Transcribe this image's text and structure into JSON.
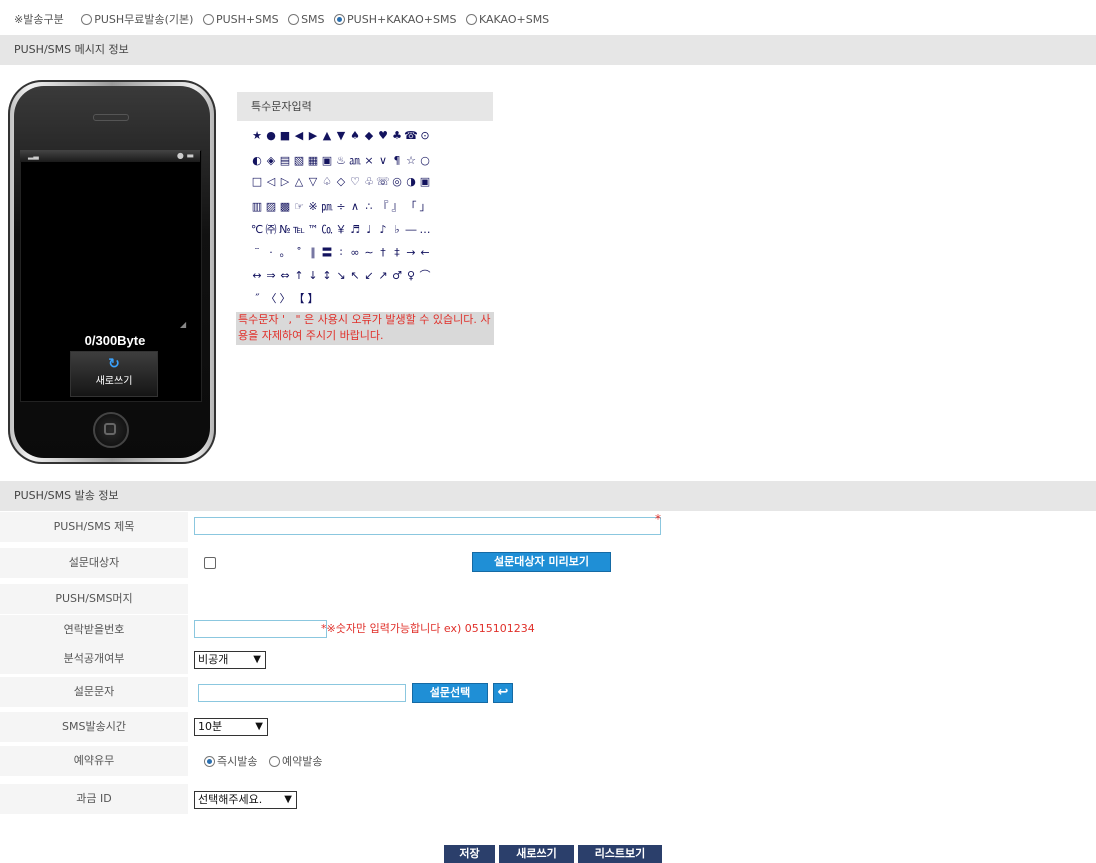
{
  "send_type": {
    "label": "※발송구분",
    "options": [
      {
        "label": "PUSH무료발송(기본)",
        "selected": false
      },
      {
        "label": "PUSH+SMS",
        "selected": false
      },
      {
        "label": "SMS",
        "selected": false
      },
      {
        "label": "PUSH+KAKAO+SMS",
        "selected": true
      },
      {
        "label": "KAKAO+SMS",
        "selected": false
      }
    ]
  },
  "message_section": {
    "title": "PUSH/SMS 메시지 정보"
  },
  "phone": {
    "byte_counter": "0/300Byte",
    "rewrite_label": "새로쓰기"
  },
  "special_chars": {
    "title": "특수문자입력",
    "rows": [
      [
        "★",
        "●",
        "■",
        "◀",
        "▶",
        "▲",
        "▼",
        "♠",
        "◆",
        "♥",
        "♣",
        "☎",
        "⊙"
      ],
      [
        "◐",
        "◈",
        "▤",
        "▧",
        "▦",
        "▣",
        "♨",
        "㏂",
        "×",
        "∨",
        "¶",
        "☆",
        "○"
      ],
      [
        "□",
        "◁",
        "▷",
        "△",
        "▽",
        "♤",
        "◇",
        "♡",
        "♧",
        "☏",
        "◎",
        "◑",
        "▣"
      ],
      [
        "▥",
        "▨",
        "▩",
        "☞",
        "※",
        "㏘",
        "÷",
        "∧",
        "∴",
        "『",
        "』",
        "「",
        "」"
      ],
      [
        "℃",
        "㈜",
        "№",
        "℡",
        "™",
        "㏇",
        "￥",
        "♬",
        "♩",
        "♪",
        "♭",
        "―",
        "…"
      ],
      [
        "¨",
        "·",
        "。",
        "˚",
        "∥",
        "〓",
        "∶",
        "∞",
        "∼",
        "†",
        "‡",
        "→",
        "←"
      ],
      [
        "↔",
        "⇒",
        "⇔",
        "↑",
        "↓",
        "↕",
        "↘",
        "↖",
        "↙",
        "↗",
        "♂",
        "♀",
        "⌒"
      ],
      [
        "˝",
        "〈",
        "〉",
        "【",
        "】"
      ]
    ],
    "warning": "특수문자 ' , \" 은 사용시 오류가 발생할 수 있습니다. 사용을 자제하여 주시기 바랍니다."
  },
  "send_section": {
    "title": "PUSH/SMS 발송 정보"
  },
  "form": {
    "title_label": "PUSH/SMS 제목",
    "target_label": "설문대상자",
    "preview_button": "설문대상자 미리보기",
    "message_label": "PUSH/SMS머지",
    "contact_label": "연락받을번호",
    "contact_hint": "*※숫자만 입력가능합니다 ex) 0515101234",
    "public_label": "분석공개여부",
    "public_value": "비공개",
    "survey_label": "설문문자",
    "survey_select_button": "설문선택",
    "sms_time_label": "SMS발송시간",
    "sms_time_value": "10분",
    "reserve_label": "예약유무",
    "reserve_options": [
      {
        "label": "즉시발송",
        "selected": true
      },
      {
        "label": "예약발송",
        "selected": false
      }
    ],
    "billing_label": "과금 ID",
    "billing_value": "선택해주세요."
  },
  "actions": {
    "save": "저장",
    "rewrite": "새로쓰기",
    "list": "리스트보기"
  },
  "colors": {
    "accent_blue": "#1f8fd6",
    "navy": "#2b3f6b",
    "required_red": "#e0302a"
  }
}
